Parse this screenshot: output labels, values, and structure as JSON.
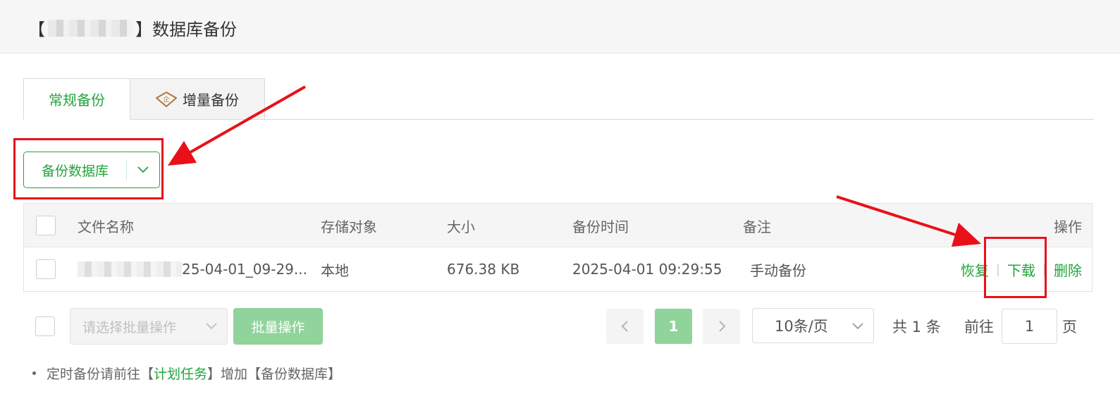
{
  "header": {
    "bracket_open": "【",
    "bracket_close": "】",
    "title": "数据库备份"
  },
  "tabs": [
    {
      "label": "常规备份",
      "active": true
    },
    {
      "label": "增量备份",
      "active": false,
      "icon": "enterprise-diamond-icon",
      "icon_text": "企"
    }
  ],
  "toolbar": {
    "backup_button": "备份数据库"
  },
  "table": {
    "columns": [
      "文件名称",
      "存储对象",
      "大小",
      "备份时间",
      "备注",
      "操作"
    ],
    "rows": [
      {
        "filename_visible": "25-04-01_09-29...",
        "storage": "本地",
        "size": "676.38 KB",
        "time": "2025-04-01 09:29:55",
        "remark": "手动备份",
        "actions": {
          "restore": "恢复",
          "download": "下载",
          "delete": "删除"
        }
      }
    ]
  },
  "batch": {
    "placeholder": "请选择批量操作",
    "button": "批量操作"
  },
  "pagination": {
    "current": "1",
    "per_page": "10条/页",
    "total": "共 1 条",
    "goto_label": "前往",
    "goto_value": "1",
    "page_suffix": "页"
  },
  "tip": {
    "prefix": "定时备份请前往【",
    "link": "计划任务",
    "suffix": "】增加【备份数据库】"
  },
  "colors": {
    "accent": "#20a53a",
    "accent_light": "#90d39b",
    "annotation_red": "#e8111a"
  }
}
